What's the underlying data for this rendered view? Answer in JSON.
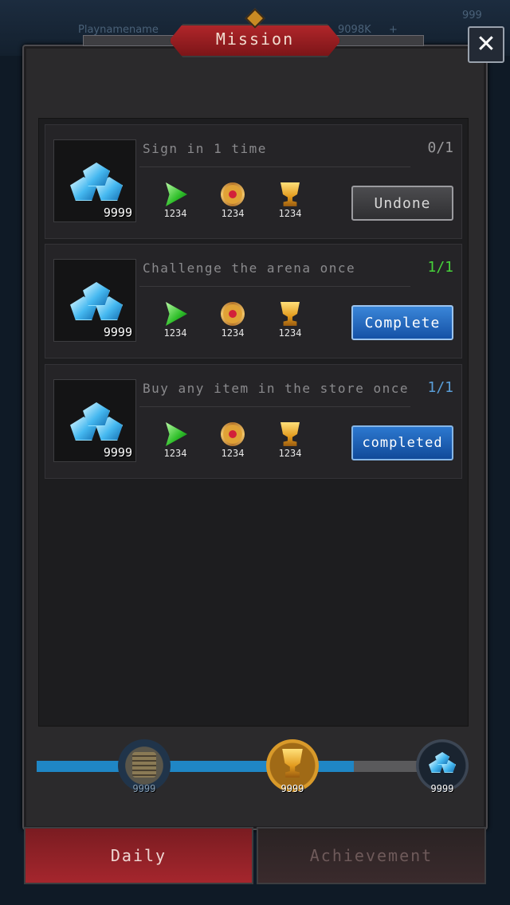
{
  "background": {
    "player_name": "Playnamename",
    "currency": "9098K",
    "plus": "+",
    "corner_value": "999"
  },
  "title": "Mission",
  "close_icon": "close-icon",
  "missions": [
    {
      "title": "Sign in 1 time",
      "progress": "0/1",
      "progress_color": "#9a9a9c",
      "reward_count": "9999",
      "rewards": [
        "1234",
        "1234",
        "1234"
      ],
      "button": "Undone",
      "state": "undone"
    },
    {
      "title": "Challenge the arena once",
      "progress": "1/1",
      "progress_color": "#46d23a",
      "reward_count": "9999",
      "rewards": [
        "1234",
        "1234",
        "1234"
      ],
      "button": "Complete",
      "state": "complete"
    },
    {
      "title": "Buy any item in the store once",
      "progress": "1/1",
      "progress_color": "#5a9ed8",
      "reward_count": "9999",
      "rewards": [
        "1234",
        "1234",
        "1234"
      ],
      "button": "completed",
      "state": "completed"
    }
  ],
  "progress_bar": {
    "fill_fraction": 0.78,
    "milestones": [
      {
        "icon": "coins-icon",
        "count": "9999"
      },
      {
        "icon": "trophy-icon",
        "count": "9999"
      },
      {
        "icon": "gems-icon",
        "count": "9999"
      }
    ]
  },
  "tabs": {
    "daily": "Daily",
    "achievement": "Achievement"
  },
  "colors": {
    "accent_red": "#a5262d",
    "button_blue": "#1f86c5",
    "gem_blue": "#45b8f0"
  }
}
